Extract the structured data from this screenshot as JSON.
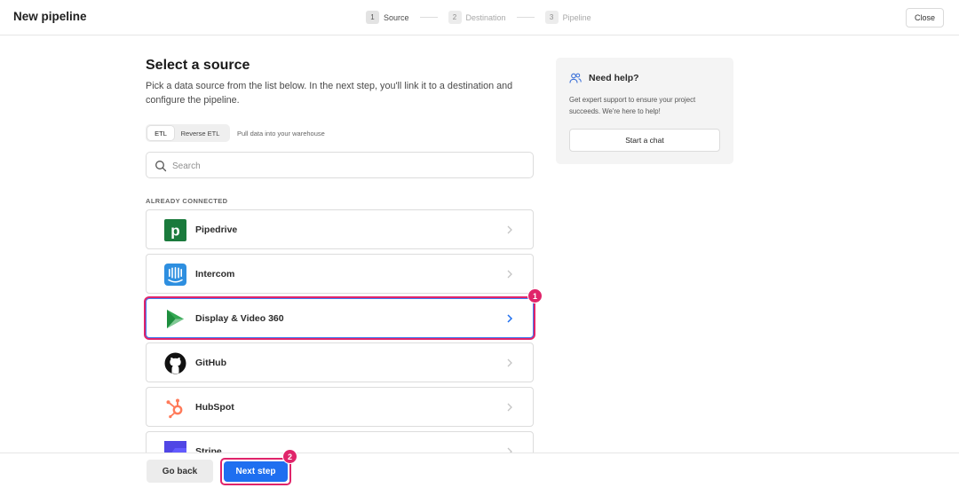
{
  "header": {
    "title": "New pipeline",
    "steps": [
      {
        "num": "1",
        "label": "Source"
      },
      {
        "num": "2",
        "label": "Destination"
      },
      {
        "num": "3",
        "label": "Pipeline"
      }
    ],
    "close_label": "Close"
  },
  "main": {
    "title": "Select a source",
    "description": "Pick a data source from the list below. In the next step, you'll link it to a destination and configure the pipeline.",
    "mode_tabs": [
      "ETL",
      "Reverse ETL"
    ],
    "mode_hint": "Pull data into your warehouse",
    "search": {
      "placeholder": "Search",
      "value": ""
    },
    "section_label": "ALREADY CONNECTED",
    "sources": [
      {
        "label": "Pipedrive",
        "icon": "pipedrive-logo-icon",
        "color": "#1a7a3c"
      },
      {
        "label": "Intercom",
        "icon": "intercom-logo-icon",
        "color": "#2e8fe0"
      },
      {
        "label": "Display & Video 360",
        "icon": "display-video-360-logo-icon",
        "color": "#34a853"
      },
      {
        "label": "GitHub",
        "icon": "github-logo-icon",
        "color": "#111111"
      },
      {
        "label": "HubSpot",
        "icon": "hubspot-logo-icon",
        "color": "#ff7a59"
      },
      {
        "label": "Stripe",
        "icon": "stripe-logo-icon",
        "color": "#635bff"
      }
    ],
    "selected_source": "Display & Video 360"
  },
  "help": {
    "title": "Need help?",
    "text": "Get expert support to ensure your project succeeds. We're here to help!",
    "button_label": "Start a chat"
  },
  "footer": {
    "back_label": "Go back",
    "next_label": "Next step"
  },
  "annotations": {
    "badge_1": "1",
    "badge_2": "2"
  },
  "colors": {
    "accent": "#1f6ff0",
    "highlight": "#e0246a"
  }
}
